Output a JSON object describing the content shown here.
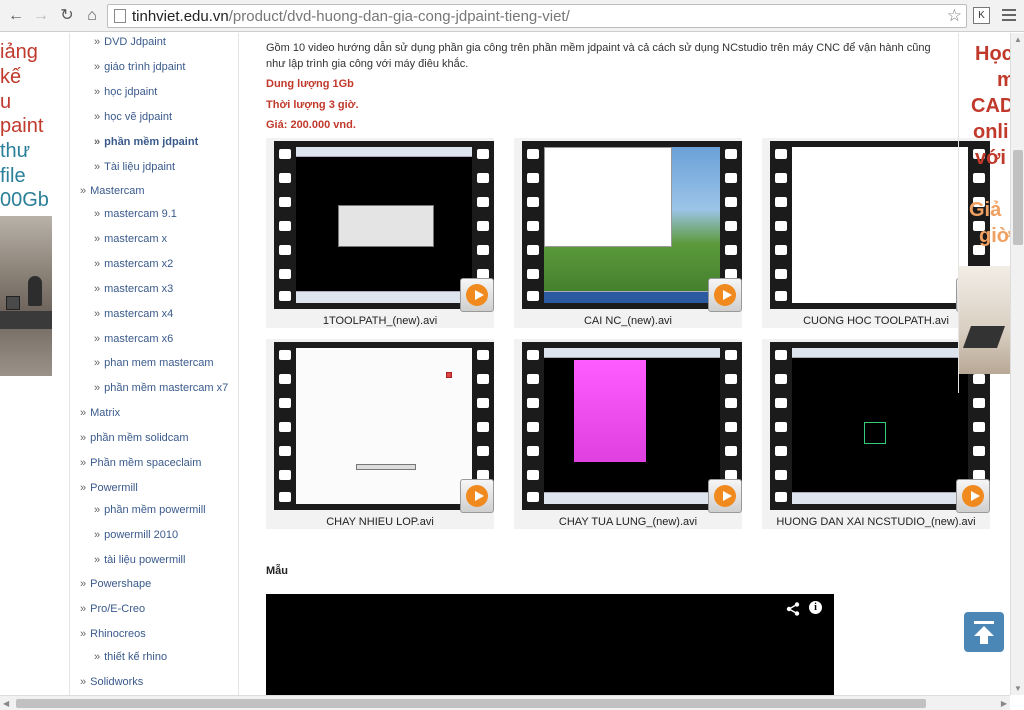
{
  "browser": {
    "url_host": "tinhviet.edu.vn",
    "url_path": "/product/dvd-huong-dan-gia-cong-jdpaint-tieng-viet/",
    "ext_label": "K"
  },
  "left_banner": {
    "lines": [
      "iảng",
      "kế",
      "u",
      "paint",
      "thư",
      "file",
      "00Gb"
    ]
  },
  "sidebar": {
    "items": [
      {
        "label": "DVD Jdpaint",
        "level": 2
      },
      {
        "label": "giáo trình jdpaint",
        "level": 2
      },
      {
        "label": "học jdpaint",
        "level": 2
      },
      {
        "label": "học vẽ jdpaint",
        "level": 2
      },
      {
        "label": "phần mềm jdpaint",
        "level": 2
      },
      {
        "label": "Tài liệu jdpaint",
        "level": 2
      },
      {
        "label": "Mastercam",
        "level": 1
      },
      {
        "label": "mastercam 9.1",
        "level": 2
      },
      {
        "label": "mastercam x",
        "level": 2
      },
      {
        "label": "mastercam x2",
        "level": 2
      },
      {
        "label": "mastercam x3",
        "level": 2
      },
      {
        "label": "mastercam x4",
        "level": 2
      },
      {
        "label": "mastercam x6",
        "level": 2
      },
      {
        "label": "phan mem mastercam",
        "level": 2
      },
      {
        "label": "phần mềm mastercam x7",
        "level": 2
      },
      {
        "label": "Matrix",
        "level": 1
      },
      {
        "label": "phần mềm solidcam",
        "level": 1
      },
      {
        "label": "Phần mềm spaceclaim",
        "level": 1
      },
      {
        "label": "Powermill",
        "level": 1
      },
      {
        "label": "phần mềm powermill",
        "level": 2
      },
      {
        "label": "powermill 2010",
        "level": 2
      },
      {
        "label": "tài liệu powermill",
        "level": 2
      },
      {
        "label": "Powershape",
        "level": 1
      },
      {
        "label": "Pro/E-Creo",
        "level": 1
      },
      {
        "label": "Rhinocreos",
        "level": 1
      },
      {
        "label": "thiết kế rhino",
        "level": 2
      },
      {
        "label": "Solidworks",
        "level": 1
      }
    ]
  },
  "main": {
    "description": "Gồm 10 video hướng dẫn sử dụng phần gia công trên phần mềm jdpaint và cả cách sử dụng NCstudio trên máy CNC để vận hành cũng như lập trình gia công với máy điêu khắc.",
    "capacity": "Dung lượng 1Gb",
    "duration": "Thời lượng 3 giờ.",
    "price": "Giá: 200.000 vnd.",
    "videos": [
      {
        "caption": "1TOOLPATH_(new).avi"
      },
      {
        "caption": "CAI NC_(new).avi"
      },
      {
        "caption": "CUONG HOC TOOLPATH.avi"
      },
      {
        "caption": "CHAY NHIEU LOP.avi"
      },
      {
        "caption": "CHAY TUA LUNG_(new).avi"
      },
      {
        "caption": "HUONG DAN XAI NCSTUDIO_(new).avi"
      }
    ],
    "section_label": "Mẫu",
    "info_glyph": "i"
  },
  "right_banner": {
    "lines": [
      "Học",
      "m",
      "CAD",
      "onli",
      "với",
      "Giả",
      "giờ"
    ]
  }
}
